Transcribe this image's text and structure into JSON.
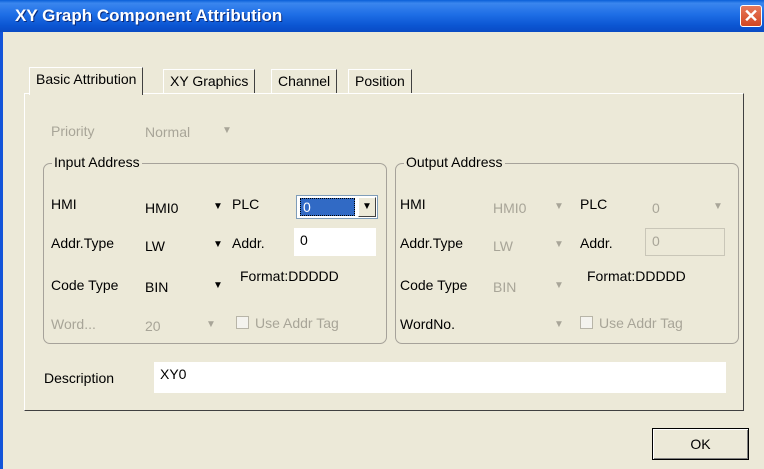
{
  "window": {
    "title": "XY Graph Component Attribution",
    "close_glyph": "✕"
  },
  "tabs": [
    "Basic Attribution",
    "XY Graphics",
    "Channel",
    "Position"
  ],
  "priority": {
    "label": "Priority",
    "value": "Normal"
  },
  "input_address": {
    "legend": "Input Address",
    "hmi_label": "HMI",
    "hmi_value": "HMI0",
    "plc_label": "PLC",
    "plc_value": "0",
    "addr_type_label": "Addr.Type",
    "addr_type_value": "LW",
    "addr_label": "Addr.",
    "addr_value": "0",
    "code_type_label": "Code Type",
    "code_type_value": "BIN",
    "format": "Format:DDDDD",
    "word_label": "Word...",
    "word_value": "20",
    "use_addr_tag": "Use Addr Tag"
  },
  "output_address": {
    "legend": "Output Address",
    "hmi_label": "HMI",
    "hmi_value": "HMI0",
    "plc_label": "PLC",
    "plc_value": "0",
    "addr_type_label": "Addr.Type",
    "addr_type_value": "LW",
    "addr_label": "Addr.",
    "addr_value": "0",
    "code_type_label": "Code Type",
    "code_type_value": "BIN",
    "format": "Format:DDDDD",
    "word_label": "WordNo.",
    "word_value": "",
    "use_addr_tag": "Use Addr Tag"
  },
  "description": {
    "label": "Description",
    "value": "XY0"
  },
  "buttons": {
    "ok": "OK"
  },
  "colors": {
    "title_bar": "#0a5fd8",
    "face": "#ece9d8",
    "selection": "#316ac5",
    "disabled_text": "#a8a598"
  }
}
